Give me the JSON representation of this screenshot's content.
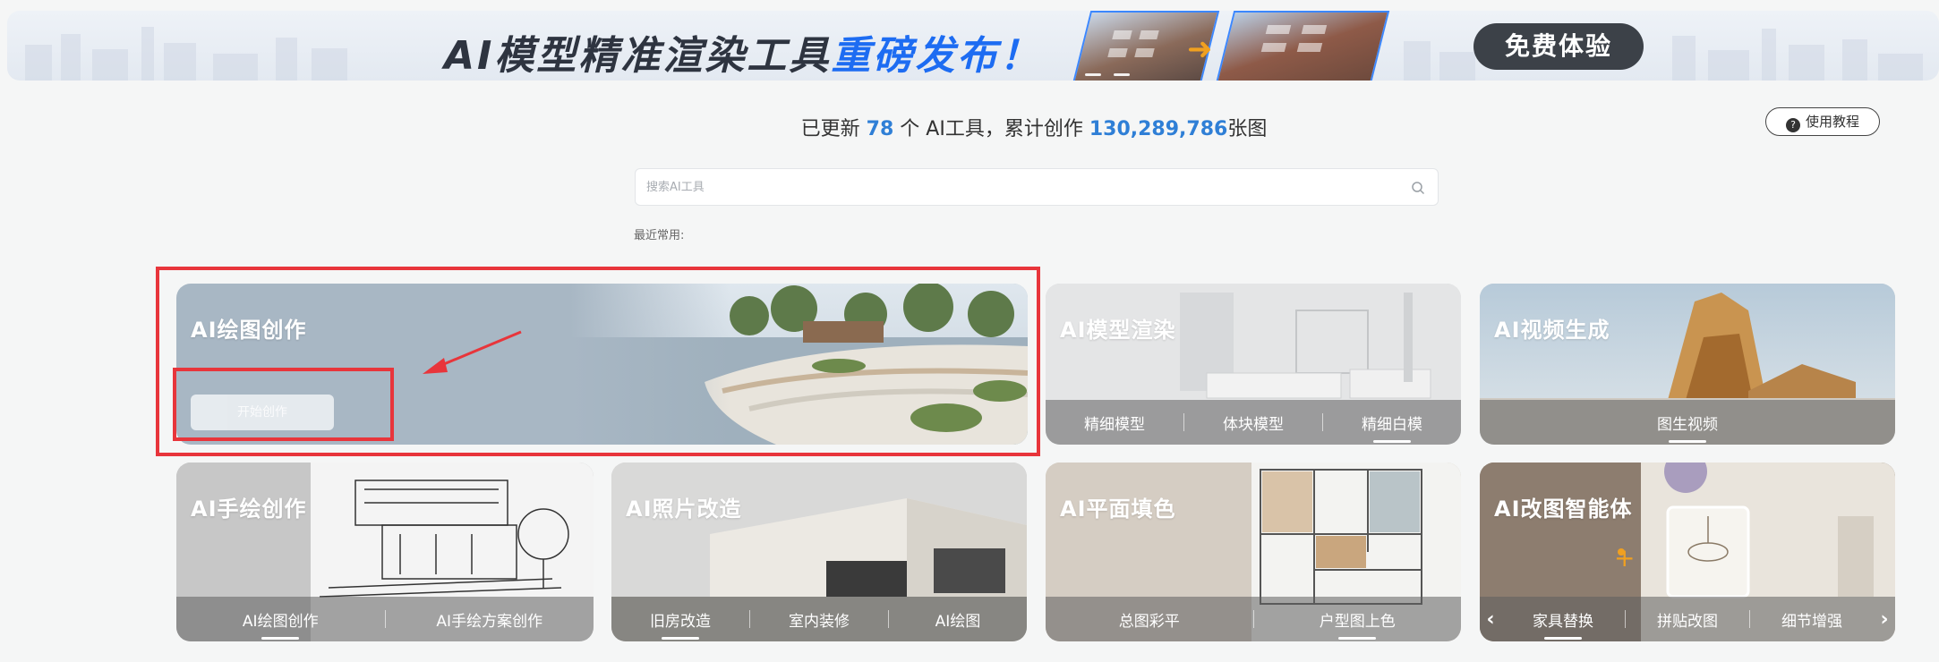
{
  "banner": {
    "title_main": "AI模型精准渲染工具",
    "title_highlight": "重磅发布！",
    "cta_label": "免费体验"
  },
  "stats": {
    "prefix": "已更新",
    "tool_count": "78",
    "mid": "个 AI工具，累计创作",
    "image_count": "130,289,786",
    "suffix": "张图"
  },
  "tutorial": {
    "label": "使用教程"
  },
  "search": {
    "placeholder": "搜索AI工具",
    "value": ""
  },
  "recent": {
    "label": "最近常用:"
  },
  "cards": [
    {
      "title": "AI绘图创作",
      "button": "开始创作"
    },
    {
      "title": "AI模型渲染",
      "tabs": [
        "精细模型",
        "体块模型",
        "精细白模"
      ],
      "active": 2
    },
    {
      "title": "AI视频生成",
      "tabs": [
        "图生视频"
      ],
      "active": 0
    },
    {
      "title": "AI手绘创作",
      "tabs": [
        "AI绘图创作",
        "AI手绘方案创作"
      ],
      "active": 0
    },
    {
      "title": "AI照片改造",
      "tabs": [
        "旧房改造",
        "室内装修",
        "AI绘图"
      ],
      "active": 0
    },
    {
      "title": "AI平面填色",
      "tabs": [
        "总图彩平",
        "户型图上色"
      ],
      "active": 1
    },
    {
      "title": "AI改图智能体",
      "tabs": [
        "家具替换",
        "拼贴改图",
        "细节增强"
      ],
      "active": 0
    }
  ],
  "colors": {
    "accent": "#2f7fd6",
    "highlight_border": "#e8353b",
    "banner_blue": "#1d6cf2"
  }
}
